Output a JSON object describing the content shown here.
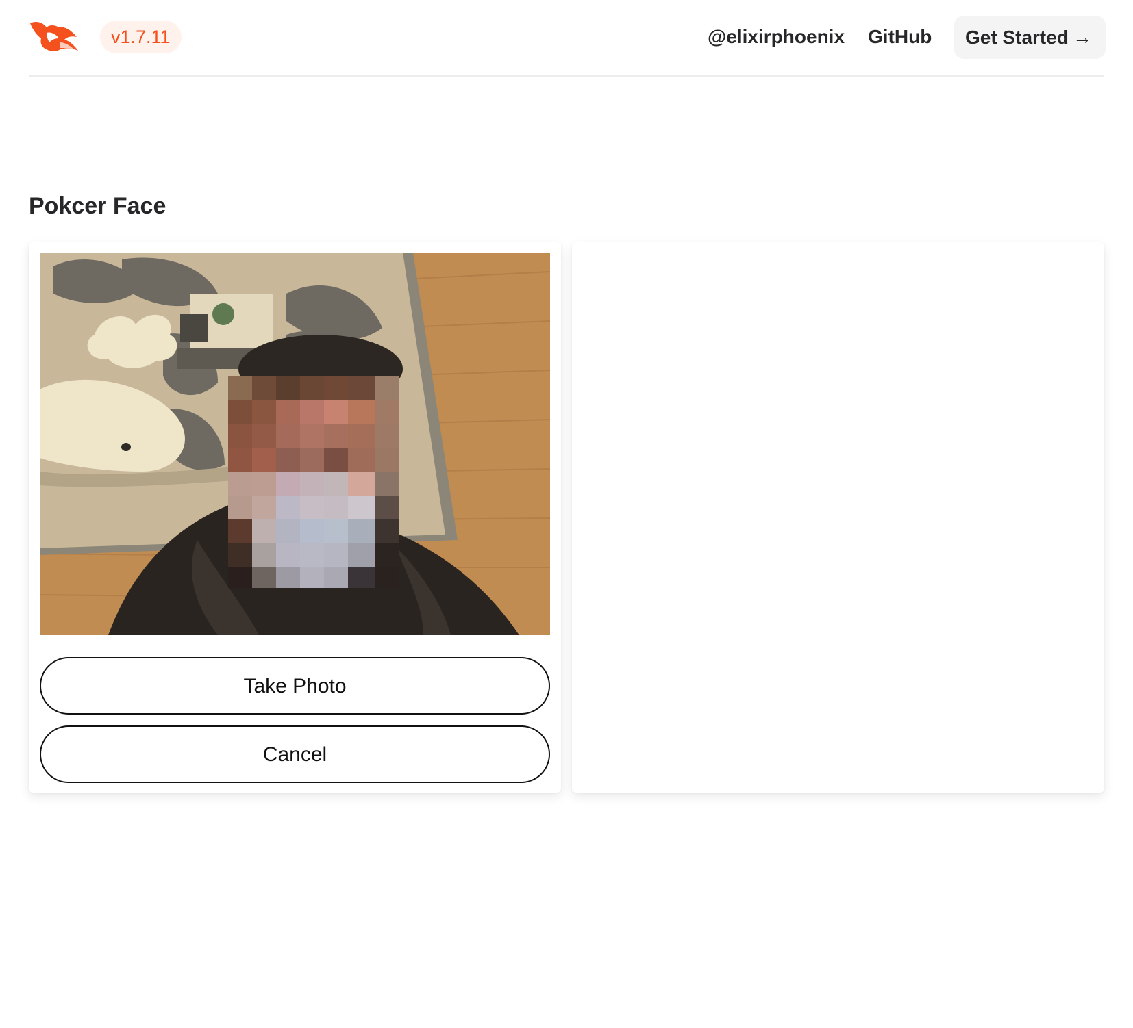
{
  "header": {
    "logo_icon": "phoenix-logo-icon",
    "version": "v1.7.11",
    "nav": {
      "twitter": "@elixirphoenix",
      "github": "GitHub",
      "get_started": "Get Started",
      "get_started_arrow": "→"
    }
  },
  "main": {
    "title": "Pokcer Face",
    "camera": {
      "content": "live-camera-feed-pixelated-face"
    },
    "buttons": {
      "take_photo": "Take Photo",
      "cancel": "Cancel"
    }
  },
  "colors": {
    "brand": "#f4511e",
    "badge_bg": "#fff2ec",
    "button_border": "#111111",
    "get_started_bg": "#f4f4f5"
  }
}
